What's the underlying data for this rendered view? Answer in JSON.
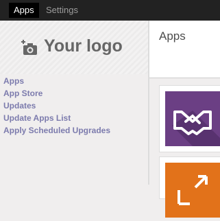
{
  "topbar": {
    "tabs": [
      {
        "label": "Apps",
        "active": true
      },
      {
        "label": "Settings",
        "active": false
      }
    ]
  },
  "sidebar": {
    "logo_text": "Your logo",
    "menu": [
      {
        "label": "Apps"
      },
      {
        "label": "App Store"
      },
      {
        "label": "Updates"
      },
      {
        "label": "Update Apps List"
      },
      {
        "label": "Apply Scheduled Upgrades"
      }
    ]
  },
  "main": {
    "title": "Apps",
    "cards": [
      {
        "icon": "handshake-icon",
        "color": "#6b3f84"
      },
      {
        "icon": "arrow-icon",
        "color": "#e2721a"
      }
    ]
  },
  "colors": {
    "topbar": "#222222",
    "link": "#7c7bad",
    "accent_purple": "#6b3f84",
    "accent_orange": "#e2721a"
  }
}
